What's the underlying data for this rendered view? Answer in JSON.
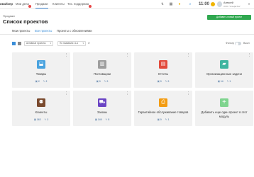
{
  "topbar": {
    "brand": "ивайзер",
    "tabs": [
      {
        "label": "Мои дела",
        "badge": true
      },
      {
        "label": "Продажи",
        "badge": false,
        "active": true
      },
      {
        "label": "Клиенты",
        "badge": false
      },
      {
        "label": "Тех. поддержка",
        "badge": true
      }
    ],
    "time": "11:00",
    "user": {
      "name": "Алексей",
      "company": "ООО \"АльфаТех\""
    }
  },
  "header": {
    "breadcrumb": "Продажи",
    "title": "Список проектов",
    "add_button": "Добавить новый проект"
  },
  "subtabs": [
    {
      "label": "Мои проекты",
      "active": false
    },
    {
      "label": "Все проекты",
      "active": true
    },
    {
      "label": "Проекты с обновлениями",
      "active": false
    }
  ],
  "toolbar": {
    "status_select": "Активные проекты",
    "sort_select": "По названию: А-я",
    "filter_label": "Фильтр",
    "toggle_label": "Выкл"
  },
  "cards": [
    {
      "title": "Товары",
      "icon": "bag-icon",
      "color": "#4aa3df",
      "a": "2",
      "b": "2"
    },
    {
      "title": "Поставщики",
      "icon": "building-icon",
      "color": "#9e9e9e",
      "a": "0",
      "b": "0"
    },
    {
      "title": "Отчеты",
      "icon": "report-icon",
      "color": "#e24a3b",
      "a": "0",
      "b": "0"
    },
    {
      "title": "Организационные задачи",
      "icon": "briefcase-icon",
      "color": "#3fb5a0",
      "a": "14",
      "b": "1"
    },
    {
      "title": "Клиенты",
      "icon": "people-icon",
      "color": "#7a4a2e",
      "a": "162",
      "b": "2"
    },
    {
      "title": "Заказы",
      "icon": "cart-icon",
      "color": "#6a44c4",
      "a": "140",
      "b": "8"
    },
    {
      "title": "Гарантийное обслуживание товаров",
      "icon": "printer-icon",
      "color": "#f39c12",
      "a": "0",
      "b": "1"
    }
  ],
  "add_card": {
    "title": "Добавить еще один проект в этот модуль"
  }
}
